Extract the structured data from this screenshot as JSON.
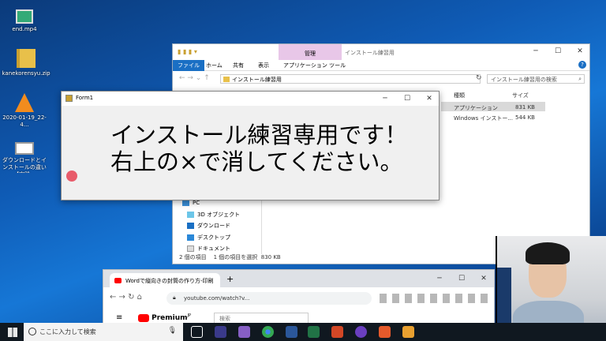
{
  "desktop": {
    "icons": [
      {
        "label": "end.mp4",
        "icon": "video-file-icon"
      },
      {
        "label": "kanekorensyu.zip",
        "icon": "zip-folder-icon"
      },
      {
        "label": "2020-01-19_22-4...",
        "icon": "vlc-icon"
      },
      {
        "label": "ダウンロードとインストールの違い【実践...",
        "icon": "video-file-icon"
      }
    ]
  },
  "explorer": {
    "title": "インストール練習用",
    "context_header": "管理",
    "tabs": [
      "ファイル",
      "ホーム",
      "共有",
      "表示",
      "アプリケーション ツール"
    ],
    "address": "インストール練習用",
    "search_placeholder": "インストール練習用の検索",
    "columns": [
      "種類",
      "サイズ"
    ],
    "rows": [
      {
        "type": "アプリケーション",
        "size": "831 KB"
      },
      {
        "type": "Windows インストー...",
        "size": "544 KB"
      }
    ],
    "nav": [
      "PC",
      "3D オブジェクト",
      "ダウンロード",
      "デスクトップ",
      "ドキュメント"
    ],
    "status": {
      "count": "2 個の項目",
      "selected": "1 個の項目を選択",
      "size": "830 KB"
    }
  },
  "form1": {
    "title": "Form1",
    "line1": "インストール練習専用です！",
    "line2": "右上の×で消してください。"
  },
  "chrome": {
    "tab_title": "Wordで縦向きの封筒の作り方-印刷",
    "url": "youtube.com/watch?v...",
    "yt_search_placeholder": "検索",
    "yt_logo": "Premium",
    "yt_region": "JP"
  },
  "taskbar": {
    "search_placeholder": "ここに入力して検索"
  },
  "colors": {
    "accent": "#1a6fc4",
    "context_tab": "#e8c7e8",
    "taskbar": "#101820"
  }
}
